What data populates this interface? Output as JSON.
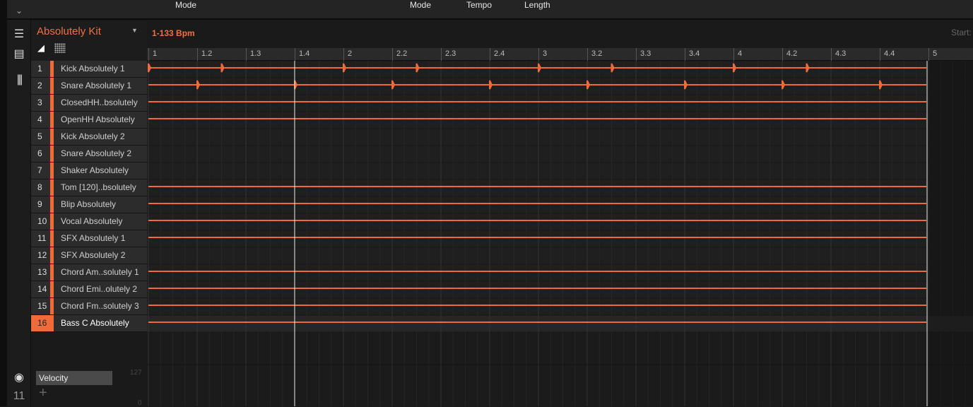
{
  "topbar": {
    "labels": [
      "Mode",
      "Mode",
      "Tempo",
      "Length"
    ]
  },
  "kit": {
    "name": "Absolutely Kit",
    "tempo_label": "1-133 Bpm",
    "start_label": "Start:"
  },
  "ruler": {
    "ticks": [
      "1",
      "1.2",
      "1.3",
      "1.4",
      "2",
      "2.2",
      "2.3",
      "2.4",
      "3",
      "3.2",
      "3.3",
      "3.4",
      "4",
      "4.2",
      "4.3",
      "4.4",
      "5"
    ]
  },
  "playhead_position": "1.4",
  "loop_end": "5",
  "accent": "#f06a3a",
  "pads": [
    {
      "num": "1",
      "name": "Kick Absolutely 1",
      "hits": [
        1,
        1.375,
        2,
        2.375,
        3,
        3.375,
        4,
        4.375
      ]
    },
    {
      "num": "2",
      "name": "Snare Absolutely 1",
      "hits": [
        1.25,
        1.75,
        2.25,
        2.75,
        3.25,
        3.75,
        4.25,
        4.75
      ]
    },
    {
      "num": "3",
      "name": "ClosedHH..bsolutely",
      "hits": []
    },
    {
      "num": "4",
      "name": "OpenHH Absolutely",
      "hits": []
    },
    {
      "num": "5",
      "name": "Kick Absolutely 2",
      "hits": null
    },
    {
      "num": "6",
      "name": "Snare Absolutely 2",
      "hits": null
    },
    {
      "num": "7",
      "name": "Shaker Absolutely",
      "hits": null
    },
    {
      "num": "8",
      "name": "Tom [120]..bsolutely",
      "hits": []
    },
    {
      "num": "9",
      "name": "Blip Absolutely",
      "hits": []
    },
    {
      "num": "10",
      "name": "Vocal Absolutely",
      "hits": []
    },
    {
      "num": "11",
      "name": "SFX Absolutely 1",
      "hits": []
    },
    {
      "num": "12",
      "name": "SFX Absolutely 2",
      "hits": null
    },
    {
      "num": "13",
      "name": "Chord Am..solutely 1",
      "hits": []
    },
    {
      "num": "14",
      "name": "Chord Emi..olutely 2",
      "hits": []
    },
    {
      "num": "15",
      "name": "Chord Fm..solutely 3",
      "hits": []
    },
    {
      "num": "16",
      "name": "Bass C Absolutely",
      "hits": [],
      "selected": true
    }
  ],
  "modulation": {
    "lane": "Velocity",
    "max": "127",
    "min": "0"
  },
  "icons": [
    "chevron-down-icon",
    "arrange-icon",
    "pattern-icon",
    "mixer-icon",
    "midi-icon",
    "automation-icon",
    "speaker-icon",
    "grid-icon"
  ]
}
